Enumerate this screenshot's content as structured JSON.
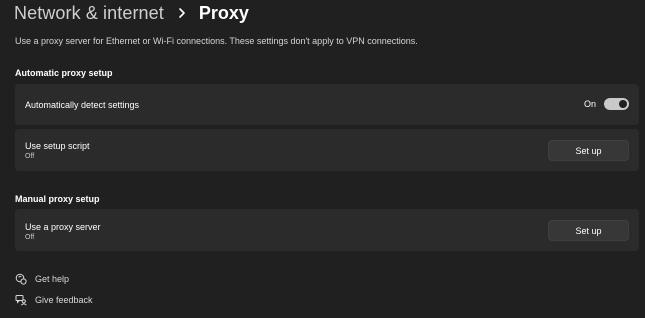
{
  "breadcrumb": {
    "parent": "Network & internet",
    "separator_icon": "chevron-right-icon",
    "current": "Proxy"
  },
  "description": "Use a proxy server for Ethernet or Wi-Fi connections. These settings don't apply to VPN connections.",
  "automatic": {
    "heading": "Automatic proxy setup",
    "detect": {
      "label": "Automatically detect settings",
      "toggle_state_label": "On",
      "toggle_on": true
    },
    "script": {
      "label": "Use setup script",
      "status": "Off",
      "button_label": "Set up"
    }
  },
  "manual": {
    "heading": "Manual proxy setup",
    "proxy_server": {
      "label": "Use a proxy server",
      "status": "Off",
      "button_label": "Set up"
    }
  },
  "links": {
    "help": {
      "label": "Get help",
      "icon": "help-icon"
    },
    "feedback": {
      "label": "Give feedback",
      "icon": "feedback-icon"
    }
  },
  "colors": {
    "background": "#202020",
    "card": "#2b2b2b",
    "button": "#373737",
    "toggle_on": "#c9c9c9"
  }
}
